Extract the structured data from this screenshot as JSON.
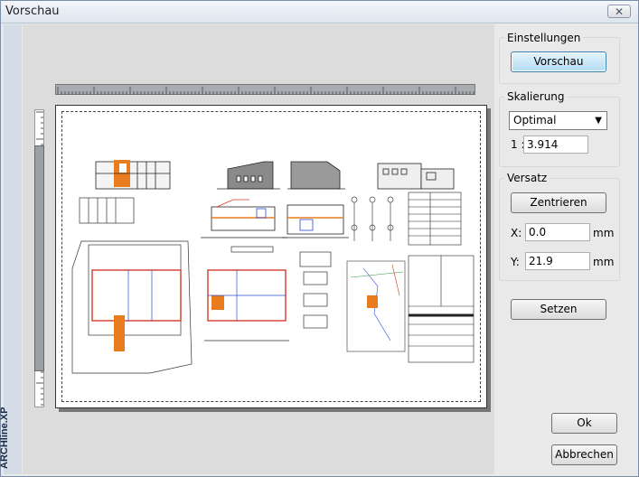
{
  "window": {
    "title": "Vorschau",
    "close_glyph": "✕"
  },
  "brand": {
    "text": "ARCHline.XP"
  },
  "settings": {
    "einstellungen_label": "Einstellungen",
    "vorschau_button": "Vorschau"
  },
  "scaling": {
    "label": "Skalierung",
    "mode": "Optimal",
    "ratio_prefix": "1 :",
    "ratio_value": "3.914"
  },
  "offset": {
    "label": "Versatz",
    "center_button": "Zentrieren",
    "x_label": "X:",
    "x_value": "0.0",
    "x_unit": "mm",
    "y_label": "Y:",
    "y_value": "21.9",
    "y_unit": "mm"
  },
  "actions": {
    "set_button": "Setzen",
    "ok_button": "Ok",
    "cancel_button": "Abbrechen"
  },
  "colors": {
    "title_bg": "#dde5ee",
    "primary_button": "#b2dcf3",
    "plan_orange": "#e87c1e",
    "plan_red": "#d23a2a"
  },
  "icons": [
    "close-icon",
    "dropdown-caret-icon"
  ]
}
